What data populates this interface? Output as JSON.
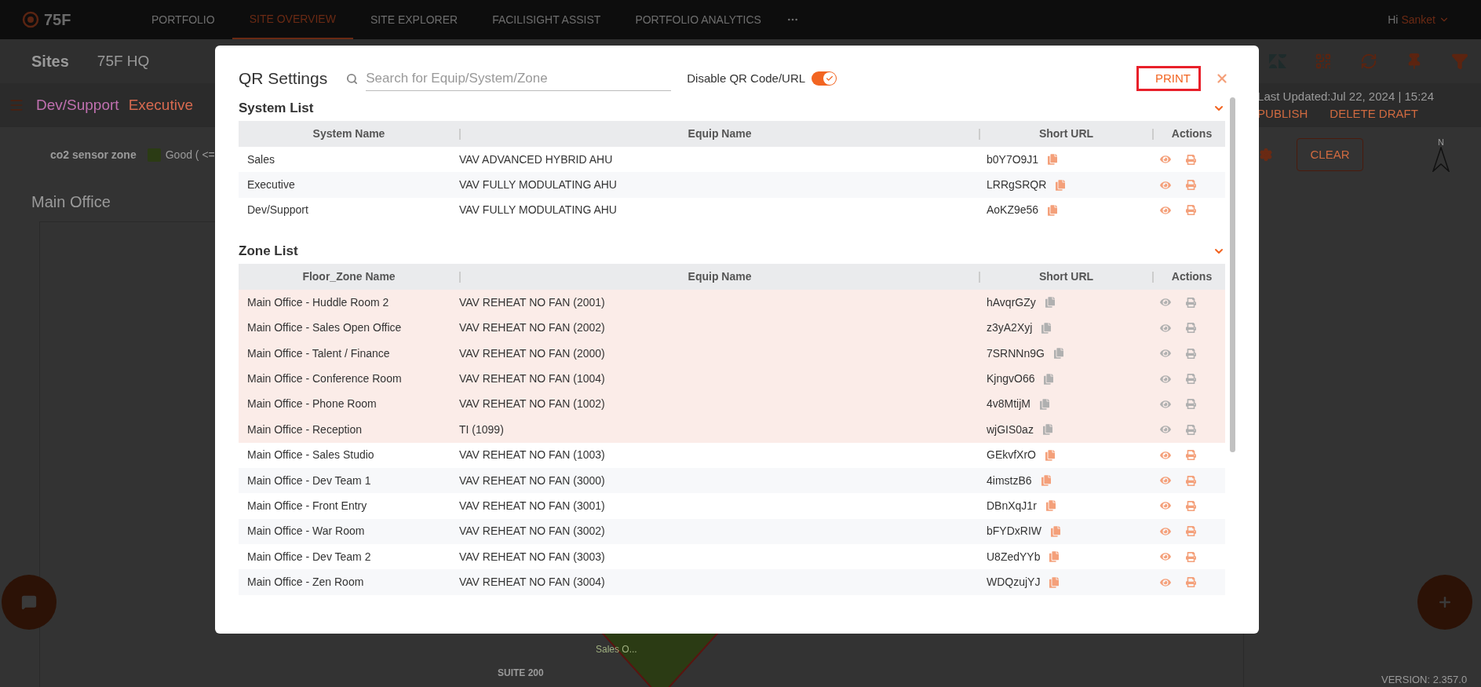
{
  "nav": {
    "logo": "75F",
    "items": [
      {
        "label": "PORTFOLIO",
        "selected": false
      },
      {
        "label": "SITE OVERVIEW",
        "selected": true
      },
      {
        "label": "SITE EXPLORER",
        "selected": false
      },
      {
        "label": "FACILISIGHT ASSIST",
        "selected": false
      },
      {
        "label": "PORTFOLIO ANALYTICS",
        "selected": false
      }
    ],
    "greeting": "Hi",
    "user": "Sanket"
  },
  "subheader": {
    "title": "Sites",
    "site": "75F HQ"
  },
  "system_tabs": [
    {
      "label": "Dev/Support",
      "selected": true
    },
    {
      "label": "Executive",
      "selected": false
    }
  ],
  "draft": {
    "last_updated": "Last Updated:Jul 22, 2024 | 15:24",
    "publish": "PUBLISH",
    "delete": "DELETE DRAFT"
  },
  "legend": {
    "label": "co2 sensor zone",
    "items": [
      {
        "label": "Good ( <=",
        "color": "#2b3b14"
      }
    ]
  },
  "floor": {
    "title": "Main Office",
    "clear": "CLEAR",
    "compass": "N",
    "zone_labels": [
      "Sales O...",
      "SUITE 200"
    ]
  },
  "version": "VERSION: 2.357.0",
  "modal": {
    "title": "QR Settings",
    "search": {
      "placeholder": "Search for Equip/System/Zone"
    },
    "disable_toggle": {
      "label": "Disable QR Code/URL",
      "on": true
    },
    "print": "PRINT",
    "sections": [
      {
        "title": "System List",
        "expanded": true,
        "columns": [
          "System Name",
          "Equip Name",
          "Short URL",
          "Actions"
        ],
        "rows": [
          {
            "name": "Sales",
            "equip": "VAV ADVANCED HYBRID AHU",
            "url": "b0Y7O9J1",
            "disabled": false
          },
          {
            "name": "Executive",
            "equip": "VAV FULLY MODULATING AHU",
            "url": "LRRgSRQR",
            "disabled": false
          },
          {
            "name": "Dev/Support",
            "equip": "VAV FULLY MODULATING AHU",
            "url": "AoKZ9e56",
            "disabled": false
          }
        ]
      },
      {
        "title": "Zone List",
        "expanded": true,
        "columns": [
          "Floor_Zone Name",
          "Equip Name",
          "Short URL",
          "Actions"
        ],
        "rows": [
          {
            "name": "Main Office - Huddle Room 2",
            "equip": "VAV REHEAT NO FAN (2001)",
            "url": "hAvqrGZy",
            "disabled": true
          },
          {
            "name": "Main Office - Sales Open Office",
            "equip": "VAV REHEAT NO FAN (2002)",
            "url": "z3yA2Xyj",
            "disabled": true
          },
          {
            "name": "Main Office - Talent / Finance",
            "equip": "VAV REHEAT NO FAN (2000)",
            "url": "7SRNNn9G",
            "disabled": true
          },
          {
            "name": "Main Office - Conference Room",
            "equip": "VAV REHEAT NO FAN (1004)",
            "url": "KjngvO66",
            "disabled": true
          },
          {
            "name": "Main Office - Phone Room",
            "equip": "VAV REHEAT NO FAN (1002)",
            "url": "4v8MtijM",
            "disabled": true
          },
          {
            "name": "Main Office - Reception",
            "equip": "TI (1099)",
            "url": "wjGIS0az",
            "disabled": true
          },
          {
            "name": "Main Office - Sales Studio",
            "equip": "VAV REHEAT NO FAN (1003)",
            "url": "GEkvfXrO",
            "disabled": false
          },
          {
            "name": "Main Office - Dev Team 1",
            "equip": "VAV REHEAT NO FAN (3000)",
            "url": "4imstzB6",
            "disabled": false
          },
          {
            "name": "Main Office - Front Entry",
            "equip": "VAV REHEAT NO FAN (3001)",
            "url": "DBnXqJ1r",
            "disabled": false
          },
          {
            "name": "Main Office - War Room",
            "equip": "VAV REHEAT NO FAN (3002)",
            "url": "bFYDxRIW",
            "disabled": false
          },
          {
            "name": "Main Office - Dev Team 2",
            "equip": "VAV REHEAT NO FAN (3003)",
            "url": "U8ZedYYb",
            "disabled": false
          },
          {
            "name": "Main Office - Zen Room",
            "equip": "VAV REHEAT NO FAN (3004)",
            "url": "WDQzujYJ",
            "disabled": false
          }
        ]
      }
    ]
  }
}
